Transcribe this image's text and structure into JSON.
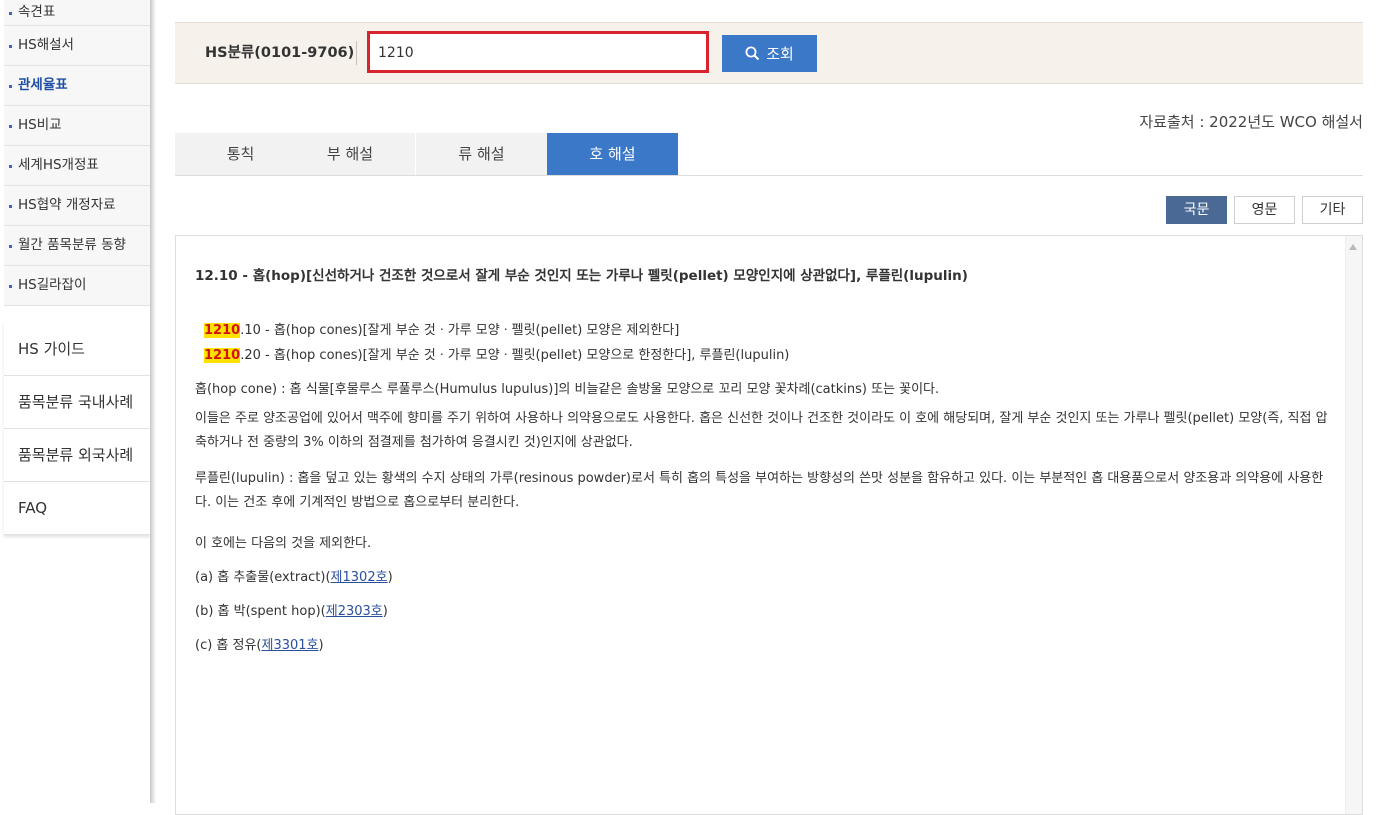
{
  "sidebar": {
    "sub_items": [
      {
        "label": "속견표",
        "active": false
      },
      {
        "label": "HS해설서",
        "active": false
      },
      {
        "label": "관세율표",
        "active": true
      },
      {
        "label": "HS비교",
        "active": false
      },
      {
        "label": "세계HS개정표",
        "active": false
      },
      {
        "label": "HS협약 개정자료",
        "active": false
      },
      {
        "label": "월간 품목분류 동향",
        "active": false
      },
      {
        "label": "HS길라잡이",
        "active": false
      }
    ],
    "main_items": [
      "HS 가이드",
      "품목분류 국내사례",
      "품목분류 외국사례",
      "FAQ"
    ]
  },
  "search": {
    "label": "HS분류(0101-9706)",
    "value": "1210",
    "button_label": "조회"
  },
  "source_text": "자료출처 : 2022년도 WCO 해설서",
  "tabs": [
    "통칙",
    "부 해설",
    "류 해설",
    "호 해설"
  ],
  "active_tab": "호 해설",
  "lang_buttons": [
    "국문",
    "영문",
    "기타"
  ],
  "active_lang": "국문",
  "content": {
    "heading_num": "12.10",
    "heading_text": " - 홉(hop)[신선하거나 건조한 것으로서 잘게 부순 것인지 또는 가루나 펠릿(pellet) 모양인지에 상관없다], 루플린(lupulin)",
    "sub1_code": "1210",
    "sub1_text": ".10 - 홉(hop cones)[잘게 부순 것ㆍ가루 모양ㆍ펠릿(pellet) 모양은 제외한다]",
    "sub2_code": "1210",
    "sub2_text": ".20 - 홉(hop cones)[잘게 부순 것ㆍ가루 모양ㆍ펠릿(pellet) 모양으로 한정한다], 루플린(lupulin)",
    "p1": "홉(hop cone) : 홉 식물[후물루스 루풀루스(Humulus lupulus)]의 비늘같은 솔방울 모양으로 꼬리 모양 꽃차례(catkins) 또는 꽃이다.",
    "p2": "이들은 주로 양조공업에 있어서 맥주에 향미를 주기 위하여 사용하나 의약용으로도 사용한다. 홉은 신선한 것이나 건조한 것이라도 이 호에 해당되며, 잘게 부순 것인지 또는 가루나 펠릿(pellet) 모양(즉, 직접 압축하거나 전 중량의 3% 이하의 점결제를 첨가하여 응결시킨 것)인지에 상관없다.",
    "p3": "루플린(lupulin) : 홉을 덮고 있는 황색의 수지 상태의 가루(resinous powder)로서 특히 홉의 특성을 부여하는 방향성의 쓴맛 성분을 함유하고 있다. 이는 부분적인 홉 대용품으로서 양조용과 의약용에 사용한다. 이는 건조 후에 기계적인 방법으로 홉으로부터 분리한다.",
    "p4": "이 호에는 다음의 것을 제외한다.",
    "excl_a_text": "(a) 홉 추출물(extract)(",
    "excl_a_link": "제1302호",
    "excl_b_text": "(b) 홉 박(spent hop)(",
    "excl_b_link": "제2303호",
    "excl_c_text": "(c) 홉 정유(",
    "excl_c_link": "제3301호",
    "close_paren": ")"
  },
  "colors": {
    "accent_blue": "#3b78c8",
    "search_highlight_border": "#d9232d",
    "code_highlight": "#ffe100",
    "active_lang_bg": "#4a6a95"
  }
}
